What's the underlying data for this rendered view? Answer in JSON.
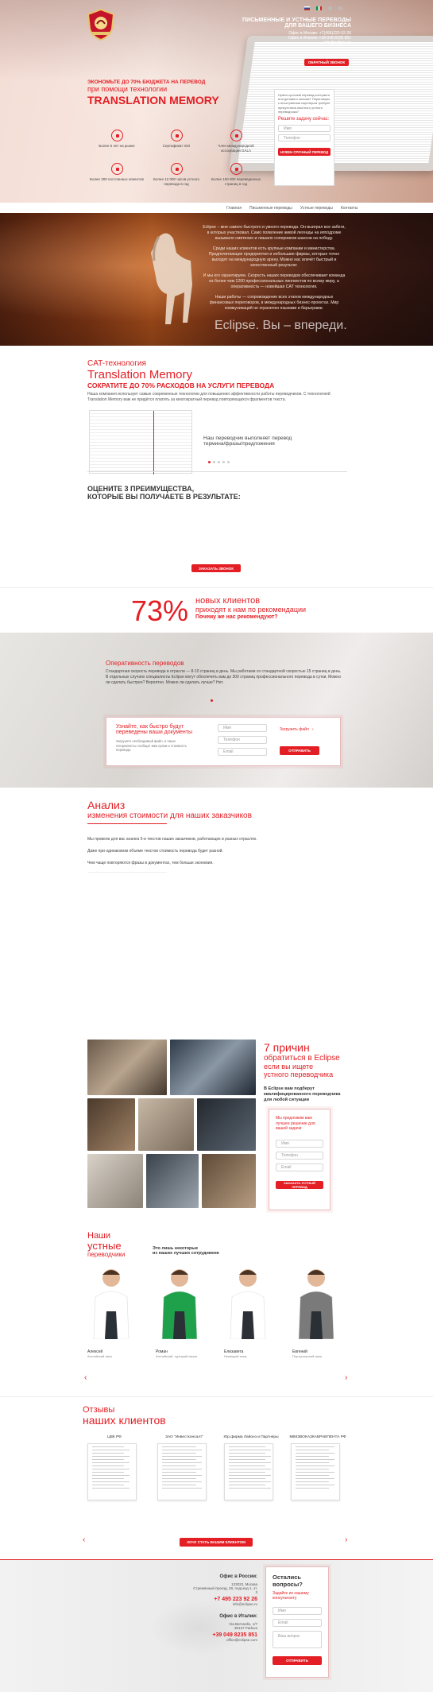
{
  "header": {
    "title_line1": "ПИСЬМЕННЫЕ И УСТНЫЕ ПЕРЕВОДЫ",
    "title_line2": "ДЛЯ ВАШЕГО БИЗНЕСА",
    "office_moscow": "Офис в Москве: +7(495)223-92-26",
    "office_italy": "Офис в Италии: +39 049 8235 851",
    "email": "info@eclipse.ru",
    "callback_button": "ОБРАТНЫЙ ЗВОНОК"
  },
  "hero": {
    "subtitle1": "ЭКОНОМЬТЕ ДО 70% БЮДЖЕТА НА ПЕРЕВОД",
    "subtitle2": "при помощи технологии",
    "headline": "TRANSLATION MEMORY",
    "features": [
      {
        "icon": "calendar-icon",
        "text": "Более 5 лет на рынке"
      },
      {
        "icon": "certificate-icon",
        "text": "Сертификат ISO"
      },
      {
        "icon": "member-icon",
        "text": "Член международной ассоциации GALA"
      },
      {
        "icon": "people-icon",
        "text": "Более 300 постоянных клиентов"
      },
      {
        "icon": "refresh-icon",
        "text": "Более 12 000 часов устного перевода в год"
      },
      {
        "icon": "pages-icon",
        "text": "Более 100 000 переведенных страниц в год"
      }
    ],
    "form": {
      "intro": "Нужен срочный перевод контракта или делового письма? Переговоры с иностранным партнером требуют присутствия опытного устного переводчика?",
      "question": "Решите задачу сейчас:",
      "name_placeholder": "Имя",
      "phone_placeholder": "Телефон",
      "button": "НУЖЕН СРОЧНЫЙ ПЕРЕВОД"
    }
  },
  "nav": {
    "items": [
      "Главная",
      "Письменные переводы",
      "Устные переводы",
      "Контакты"
    ]
  },
  "horse": {
    "p1": "Eclipse – мне самого быстрого и умного перевода. Он выиграл все забеги, в которых участвовал. Само появление живой легенды на ипподроме вызывало смятение и лишало соперников шансов на победу.",
    "p2": "Среди наших клиентов есть крупные компании и министерства. Предпочитающие предприятия и небольшие фирмы, которые точно выходят на международную арену. Можно нас влечёт быстрый и качественный результат.",
    "p3": "И мы его гарантируем. Скорость наших переводов обеспечивает команда из более чем 1200 профессиональных лингвистов по всему миру, а оперативность — новейшая CAT технология.",
    "p4": "Наши работы — сопровождение всех этапов международных финансовых переговоров, в международных бизнес-проектах. Мир коммуникаций не ограничен языками и барьерами.",
    "slogan": "Eclipse. Вы – впереди."
  },
  "cat": {
    "label": "CAT-технология",
    "title": "Translation Memory",
    "subtitle": "СОКРАТИТЕ ДО 70% РАСХОДОВ НА УСЛУГИ ПЕРЕВОДА",
    "text": "Наша компания использует самые современные технологии для повышения эффективности работы переводчиков. С технологией Translation Memory вам не придётся платить за многократный перевод повторяющихся фрагментов текста.",
    "caption_line1": "Наш переводчик выполняет перевод",
    "caption_line2": "термина/фразы/предложения"
  },
  "advantages": {
    "title_line1": "ОЦЕНИТЕ 3 ПРЕИМУЩЕСТВА,",
    "title_line2": "КОТОРЫЕ ВЫ ПОЛУЧАЕТЕ В РЕЗУЛЬТАТЕ:",
    "button": "ЗАКАЗАТЬ ЗВОНОК"
  },
  "stats": {
    "percent": "73%",
    "line1": "новых клиентов",
    "line2": "приходят к нам по рекомендации",
    "line3": "Почему же нас рекомендуют?"
  },
  "speed": {
    "title": "Оперативность переводов",
    "text": "Стандартная скорость перевода в отрасли — 8-10 страниц в день. Мы работаем со стандартной скоростью 15 страниц в день. В отдельных случаях специалисты Eclipse могут обеспечить вам до 300 страниц профессионального перевода в сутки. Можно ли сделать быстрее? Вероятно. Можно ли сделать лучше? Нет.",
    "form_title_line1": "Узнайте, как быстро будут",
    "form_title_line2": "переведены ваши документы",
    "form_text": "Загрузите необходимый файл, и наши специалисты сообщат вам сроки и стоимость перевода",
    "name_placeholder": "Имя",
    "phone_placeholder": "Телефон",
    "email_placeholder": "Email",
    "upload_label": "Загрузить файл",
    "button": "ОТПРАВИТЬ"
  },
  "analysis": {
    "title": "Анализ",
    "subtitle": "изменения стоимости для наших заказчиков",
    "p1": "Мы провели для вас анализ 5-и текстов наших заказчиков, работающих в разных отраслях.",
    "p2": "Даже при одинаковом объеме текстов стоимость перевода будет разной.",
    "p3": "Чем чаще повторяются фразы в документах, тем больше экономия."
  },
  "reasons": {
    "title_line1": "7 причин",
    "title_line2": "обратиться в Eclipse",
    "title_line3": "если вы ищете",
    "title_line4": "устного переводчика",
    "subtitle": "В Eclipse вам подберут квалифицированного переводчика для любой ситуации",
    "form_title": "Мы предложим вам лучшее решение для вашей задачи",
    "name_placeholder": "Имя",
    "phone_placeholder": "Телефон",
    "email_placeholder": "Email",
    "button": "ЗАКАЗАТЬ УСТНЫЙ ПЕРЕВОД"
  },
  "translators": {
    "title_line1": "Наши",
    "title_line2": "устные",
    "title_line3": "переводчики",
    "note_line1": "Это лишь некоторые",
    "note_line2": "из наших лучших сотрудников",
    "people": [
      {
        "name": "Алексей",
        "role": "Английский язык"
      },
      {
        "name": "Роман",
        "role": "Английский, турецкий языки"
      },
      {
        "name": "Елизавета",
        "role": "Немецкий язык"
      },
      {
        "name": "Евгений",
        "role": "Португальский язык"
      }
    ]
  },
  "reviews": {
    "title_line1": "Отзывы",
    "title_line2": "наших клиентов",
    "companies": [
      "ЦВК РФ",
      "ЗАО \"Инвестконсалт\"",
      "Юр.фирма Лайонз и Партнеры",
      "МВКЗВОКАЗКАВРАВПЕНТА РФ"
    ],
    "button": "ХОЧУ СТАТЬ ВАШИМ КЛИЕНТОМ"
  },
  "footer": {
    "russia_label": "Офис в России:",
    "russia_addr1": "123022, Москва",
    "russia_addr2": "Стремянный проезд, 28, подъезд 1, эт. 3",
    "russia_phone": "+7 495 223 92 26",
    "russia_email": "info@eclipse.ru",
    "italy_label": "Офис в Италии:",
    "italy_addr1": "Via Bernardis, 1/7",
    "italy_addr2": "35137 Padova",
    "italy_phone": "+39 049 8235 851",
    "italy_email": "office@eclipse.com",
    "question_title": "Остались вопросы?",
    "question_sub": "Задайте их нашему консультанту",
    "name_placeholder": "Имя",
    "email_placeholder": "Email",
    "question_placeholder": "Ваш вопрос",
    "button": "ОТПРАВИТЬ"
  },
  "colors": {
    "accent": "#e31e24"
  }
}
